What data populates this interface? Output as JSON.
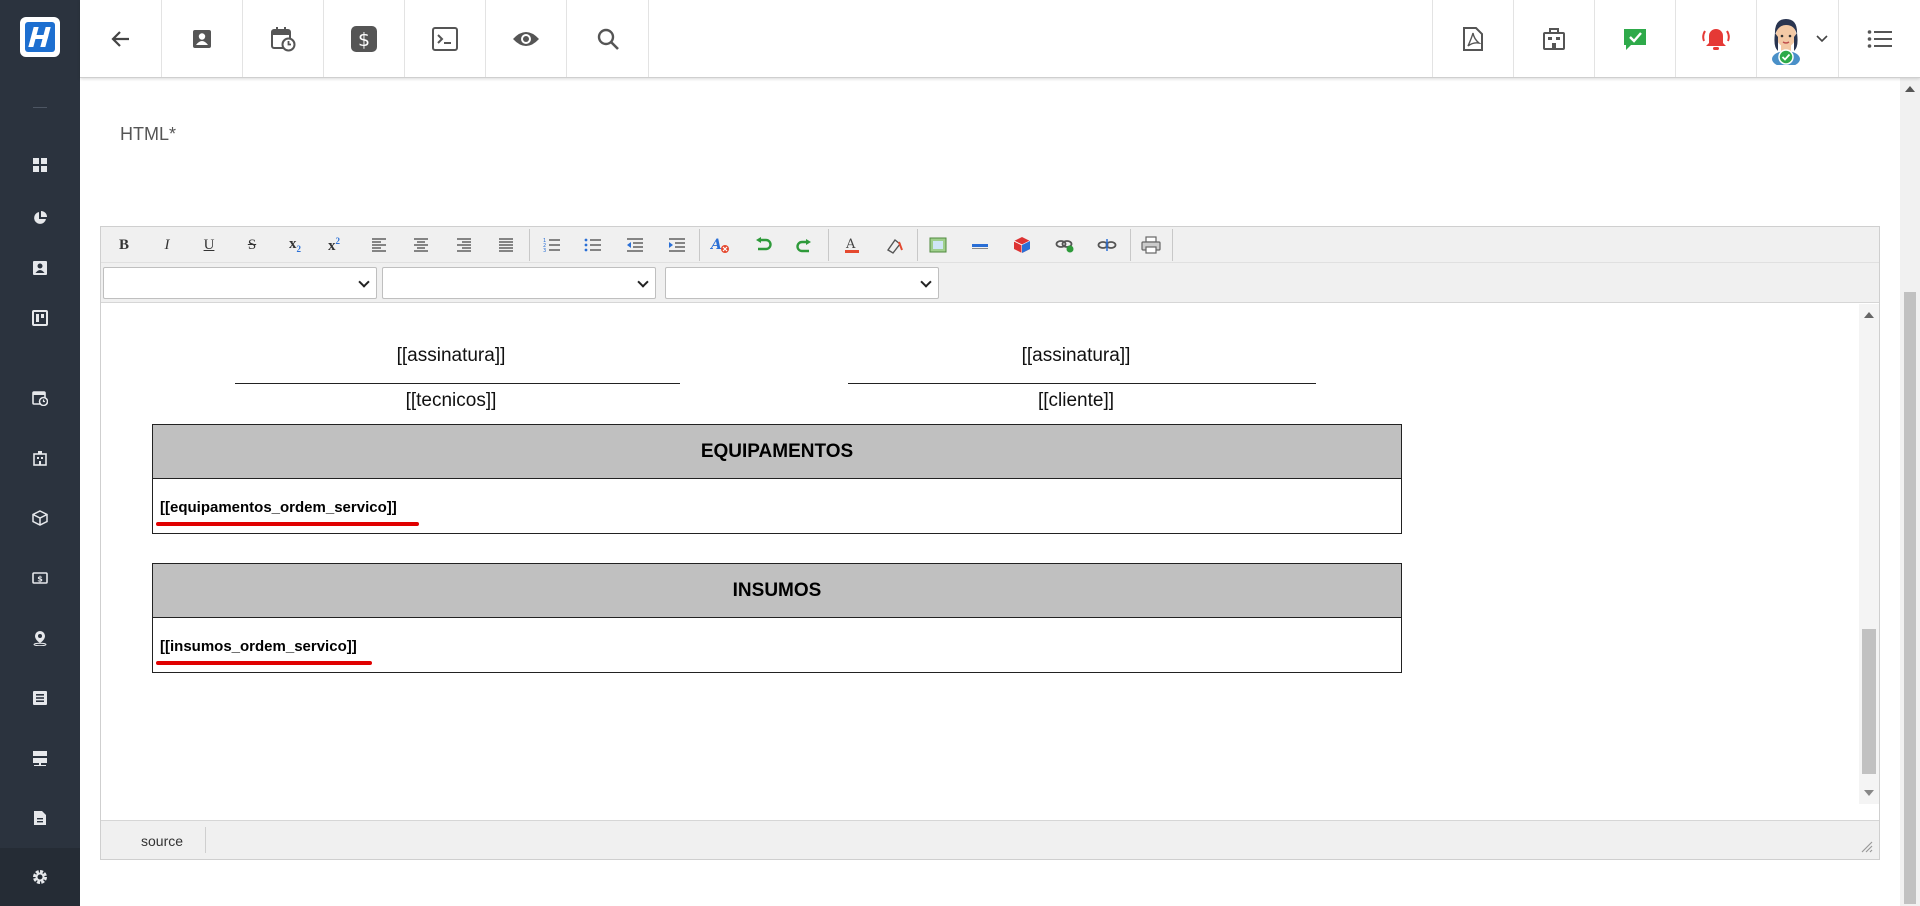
{
  "sidebar": {
    "logo": "logo-icon",
    "items": [
      {
        "name": "dashboard-icon"
      },
      {
        "name": "chart-pie-icon"
      },
      {
        "name": "contact-card-icon"
      },
      {
        "name": "kanban-board-icon"
      },
      {
        "name": "calendar-clock-icon"
      },
      {
        "name": "building-icon"
      },
      {
        "name": "cube-icon"
      },
      {
        "name": "money-icon"
      },
      {
        "name": "map-pin-icon"
      },
      {
        "name": "list-icon"
      },
      {
        "name": "server-icon"
      },
      {
        "name": "document-icon"
      }
    ],
    "settings": "gear-icon"
  },
  "topbar": {
    "left_icons": [
      "back-arrow-icon",
      "contact-card-icon",
      "calendar-clock-icon",
      "dollar-icon",
      "terminal-icon",
      "eye-icon",
      "search-icon"
    ],
    "right_icons": [
      "pdf-icon",
      "building-icon",
      "message-check-icon",
      "alarm-bell-icon",
      "user-avatar",
      "menu-list-icon"
    ],
    "accent_green": "#2eaa4a",
    "accent_red": "#e53935"
  },
  "form": {
    "label": "HTML*"
  },
  "editor": {
    "toolbar_icons": [
      "bold-icon",
      "italic-icon",
      "underline-icon",
      "strikethrough-icon",
      "subscript-icon",
      "superscript-icon",
      "align-left-icon",
      "align-center-icon",
      "align-right-icon",
      "align-justify-icon",
      "ordered-list-icon",
      "unordered-list-icon",
      "outdent-icon",
      "indent-icon",
      "remove-format-icon",
      "undo-icon",
      "redo-icon",
      "font-color-icon",
      "highlight-icon",
      "image-icon",
      "horizontal-rule-icon",
      "insert-box-icon",
      "link-icon",
      "unlink-icon",
      "print-icon"
    ],
    "content": {
      "signatures": [
        {
          "placeholder": "[[assinatura]]",
          "name": "[[tecnicos]]"
        },
        {
          "placeholder": "[[assinatura]]",
          "name": "[[cliente]]"
        }
      ],
      "tables": [
        {
          "header": "EQUIPAMENTOS",
          "body": "[[equipamentos_ordem_servico]]"
        },
        {
          "header": "INSUMOS",
          "body": "[[insumos_ordem_servico]]"
        }
      ]
    },
    "status_label": "source"
  }
}
